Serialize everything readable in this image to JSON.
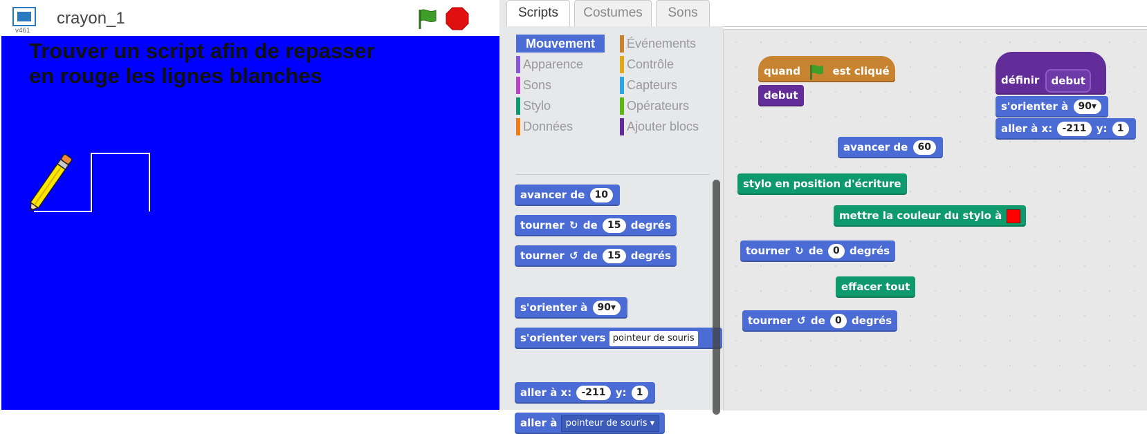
{
  "stage_header": {
    "title": "crayon_1",
    "version": "v461"
  },
  "stage": {
    "background_color": "#0000ff",
    "instruction_line1": "Trouver un script afin de repasser",
    "instruction_line2": "en rouge les lignes blanches"
  },
  "tabs": [
    {
      "label": "Scripts",
      "active": true
    },
    {
      "label": "Costumes",
      "active": false
    },
    {
      "label": "Sons",
      "active": false
    }
  ],
  "categories": {
    "left": [
      {
        "label": "Mouvement",
        "color": "#4a6cd4",
        "selected": true
      },
      {
        "label": "Apparence",
        "color": "#8a55d7"
      },
      {
        "label": "Sons",
        "color": "#bb42c3"
      },
      {
        "label": "Stylo",
        "color": "#0e9a6c"
      },
      {
        "label": "Données",
        "color": "#ee7d16"
      }
    ],
    "right": [
      {
        "label": "Événements",
        "color": "#c88330"
      },
      {
        "label": "Contrôle",
        "color": "#e1a91a"
      },
      {
        "label": "Capteurs",
        "color": "#2ca5e2"
      },
      {
        "label": "Opérateurs",
        "color": "#5cb712"
      },
      {
        "label": "Ajouter blocs",
        "color": "#632d99"
      }
    ]
  },
  "palette_blocks": {
    "move": {
      "text": "avancer de",
      "value": "10"
    },
    "turn_right": {
      "text1": "tourner",
      "text2": "de",
      "value": "15",
      "text3": "degrés"
    },
    "turn_left": {
      "text1": "tourner",
      "text2": "de",
      "value": "15",
      "text3": "degrés"
    },
    "point_dir": {
      "text": "s'orienter à",
      "value": "90▾"
    },
    "point_towards": {
      "text": "s'orienter vers",
      "dropdown": "pointeur de souris"
    },
    "goto_xy": {
      "text1": "aller à x:",
      "x": "-211",
      "text2": "y:",
      "y": "1"
    },
    "goto": {
      "text": "aller à",
      "dropdown": "pointeur de souris"
    }
  },
  "script_blocks": {
    "when_flag": {
      "text1": "quand",
      "text2": "est cliqué"
    },
    "debut_call": {
      "text": "debut"
    },
    "define": {
      "text": "définir",
      "name": "debut"
    },
    "def_point_dir": {
      "text": "s'orienter à",
      "value": "90▾"
    },
    "def_goto_xy": {
      "text1": "aller à x:",
      "x": "-211",
      "text2": "y:",
      "y": "1"
    },
    "move_60": {
      "text": "avancer de",
      "value": "60"
    },
    "pen_down": {
      "text": "stylo en position d'écriture"
    },
    "set_pen_color": {
      "text": "mettre la couleur du stylo à",
      "color": "#ff0000"
    },
    "turn_right_0": {
      "text1": "tourner",
      "text2": "de",
      "value": "0",
      "text3": "degrés"
    },
    "clear": {
      "text": "effacer tout"
    },
    "turn_left_0": {
      "text1": "tourner",
      "text2": "de",
      "value": "0",
      "text3": "degrés"
    }
  }
}
